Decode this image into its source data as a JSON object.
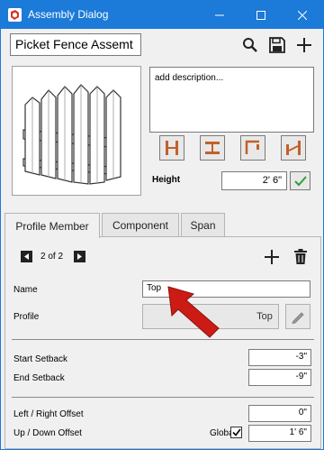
{
  "window": {
    "title": "Assembly Dialog"
  },
  "header": {
    "assembly_name": "Picket Fence Assemt"
  },
  "description": {
    "placeholder": "add description..."
  },
  "height": {
    "label": "Height",
    "value": "2' 6\""
  },
  "tabs": [
    {
      "label": "Profile Member",
      "active": true
    },
    {
      "label": "Component",
      "active": false
    },
    {
      "label": "Span",
      "active": false
    }
  ],
  "pager": {
    "text": "2 of 2"
  },
  "member": {
    "name_label": "Name",
    "name_value": "Top",
    "profile_label": "Profile",
    "profile_value": "Top",
    "start_setback_label": "Start Setback",
    "start_setback_value": "-3\"",
    "end_setback_label": "End Setback",
    "end_setback_value": "-9\"",
    "lr_offset_label": "Left / Right Offset",
    "lr_offset_value": "0\"",
    "ud_offset_label": "Up / Down Offset",
    "ud_offset_value": "1' 6\"",
    "global_label": "Global",
    "global_checked": true
  },
  "colors": {
    "titlebar": "#1c7ad8",
    "accent": "#c0612b",
    "check": "#2e9e3e",
    "annotation_arrow": "#cc1b14"
  }
}
